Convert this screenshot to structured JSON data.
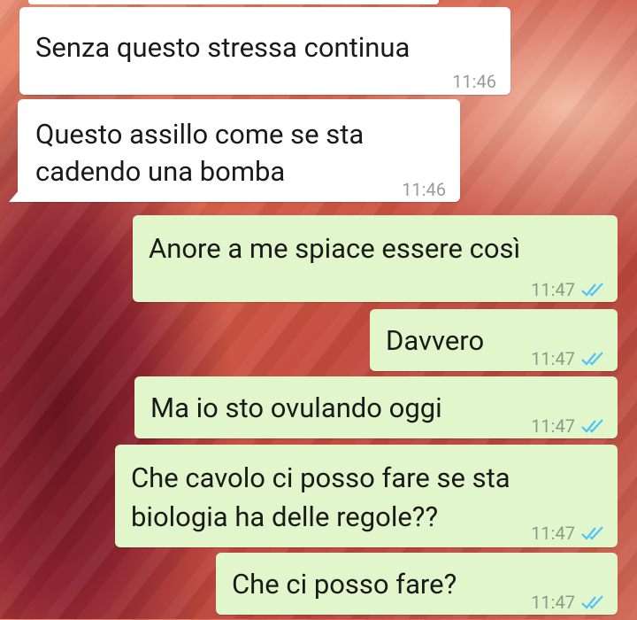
{
  "messages": [
    {
      "text": "Senza questo stressa continua",
      "time": "11:46"
    },
    {
      "line1": "Questo assillo come se sta",
      "line2": "cadendo una bomba",
      "time": "11:46"
    },
    {
      "text": "Anore a me spiace essere così",
      "time": "11:47"
    },
    {
      "text": "Davvero",
      "time": "11:47"
    },
    {
      "text": "Ma io sto ovulando oggi",
      "time": "11:47"
    },
    {
      "line1": "Che cavolo ci posso fare se sta",
      "line2": "biologia ha delle regole??",
      "time": "11:47"
    },
    {
      "text": "Che ci posso fare?",
      "time": "11:47"
    }
  ],
  "colors": {
    "incoming_bubble": "#ffffff",
    "outgoing_bubble": "#e1f7cb",
    "read_receipt": "#4fc3f7"
  },
  "icons": {
    "receipt": "double-check-icon"
  }
}
